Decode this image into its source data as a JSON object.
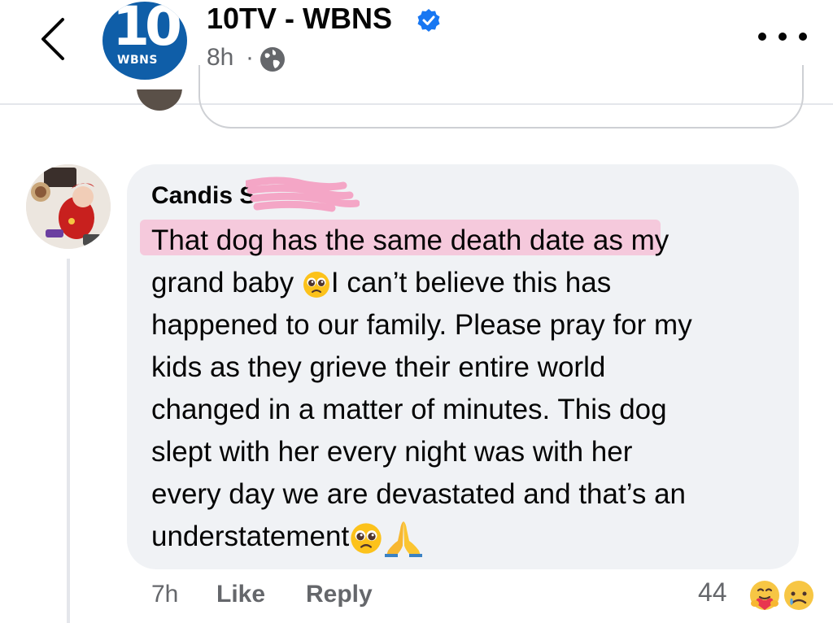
{
  "header": {
    "back_icon": "chevron-left-icon",
    "page_name": "10TV - WBNS",
    "logo_number": "10",
    "logo_subtext": "WBNS",
    "post_time": "8h",
    "separator": "·",
    "privacy_icon": "globe-icon",
    "more_icon": "more-horizontal-icon"
  },
  "comment": {
    "author": "Candis S",
    "text": "That dog has the same death date as my grand baby 🥺I can’t believe this has happened to our family. Please pray for my kids as they grieve their entire world changed in a matter of minutes. This dog slept with her every night was with her every day we are devastated and that’s an understatement🥺🙏",
    "lines": [
      "That dog has the same death date as my",
      "grand baby ",
      "I can’t believe this has",
      "happened to our family. Please pray for my",
      "kids as they grieve their entire world",
      "changed in a matter of minutes. This dog",
      "slept with her every night was with her",
      "every day we are devastated and that’s an",
      "understatement"
    ],
    "footer": {
      "time": "7h",
      "like_label": "Like",
      "reply_label": "Reply",
      "reaction_count": "44",
      "reactions": [
        "care-reaction-icon",
        "sad-reaction-icon"
      ]
    }
  },
  "colors": {
    "secondary_text": "#65676b",
    "bubble_bg": "#f0f2f5",
    "verified_blue": "#1877f2",
    "logo_blue": "#0f5ea8",
    "highlight_pink": "#f5c9dc"
  }
}
